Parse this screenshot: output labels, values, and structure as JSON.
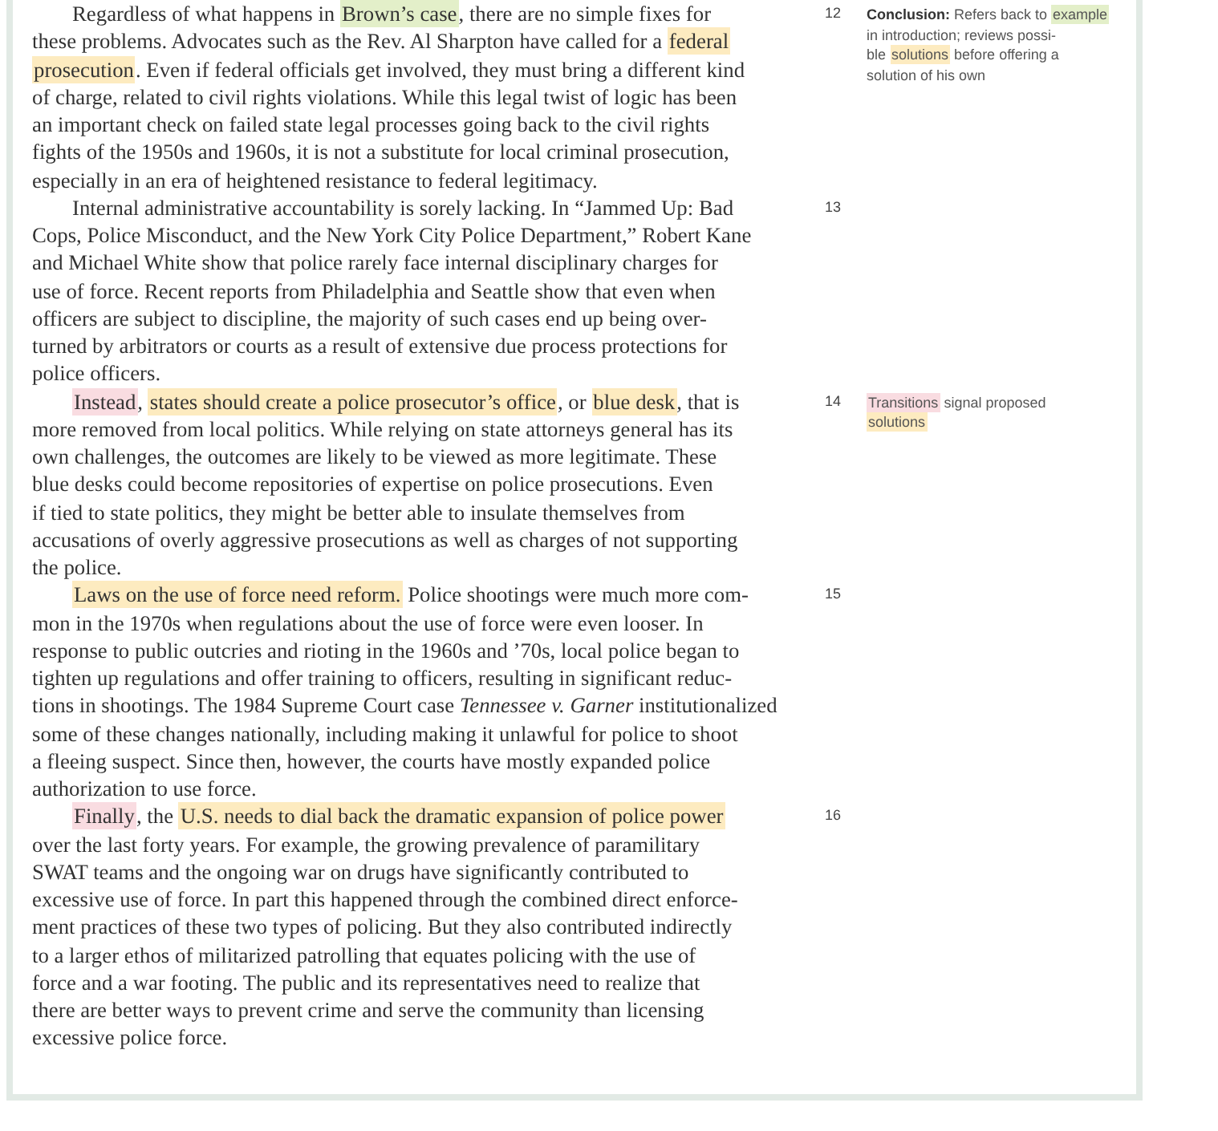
{
  "paragraphs": [
    {
      "number": "12",
      "lines": [
        [
          {
            "text": "Regardless of what happens in "
          },
          {
            "text": "Brown’s case",
            "color": "#e3efc9"
          },
          {
            "text": ", there are no simple fixes for"
          }
        ],
        [
          {
            "text": "these problems. Advocates such as the Rev. Al Sharpton have called for a "
          },
          {
            "text": "federal",
            "color": "#fdebc0"
          }
        ],
        [
          {
            "text": "prosecution",
            "color": "#fdebc0"
          },
          {
            "text": ". Even if federal officials get involved, they must bring a different kind"
          }
        ],
        [
          {
            "text": "of charge, related to civil rights violations. While this legal twist of logic has been"
          }
        ],
        [
          {
            "text": "an important check on failed state legal processes going back to the civil rights"
          }
        ],
        [
          {
            "text": "fights of the 1950s and 1960s, it is not a substitute for local criminal prosecution,"
          }
        ],
        [
          {
            "text": "especially in an era of heightened resistance to federal legitimacy."
          }
        ]
      ],
      "note": [
        [
          {
            "text": "**Conclusion:** Refers back to "
          },
          {
            "text": "example",
            "color": "#e3efc9"
          }
        ],
        [
          {
            "text": "in introduction; reviews possi-"
          }
        ],
        [
          {
            "text": "ble "
          },
          {
            "text": "solutions",
            "color": "#fdebc0"
          },
          {
            "text": " before offering a"
          }
        ],
        [
          {
            "text": "solution of his own"
          }
        ]
      ]
    },
    {
      "number": "13",
      "lines": [
        [
          {
            "text": "Internal administrative accountability is sorely lacking. In “Jammed Up: Bad"
          }
        ],
        [
          {
            "text": "Cops, Police Misconduct, and the New York City Police Department,” Robert Kane"
          }
        ],
        [
          {
            "text": "and Michael White show that police rarely face internal disciplinary charges for"
          }
        ],
        [
          {
            "text": "use of force. Recent reports from Philadelphia and Seattle show that even when"
          }
        ],
        [
          {
            "text": "officers are subject to discipline, the majority of such cases end up being over-"
          }
        ],
        [
          {
            "text": "turned by arbitrators or courts as a result of extensive due process protections for"
          }
        ],
        [
          {
            "text": "police officers."
          }
        ]
      ]
    },
    {
      "number": "14",
      "lines": [
        [
          {
            "text": "Instead",
            "color": "#f9dce1"
          },
          {
            "text": ", "
          },
          {
            "text": "states should create a police prosecutor’s office",
            "color": "#fdebc0"
          },
          {
            "text": ", or "
          },
          {
            "text": "blue desk",
            "color": "#fdebc0"
          },
          {
            "text": ", that is"
          }
        ],
        [
          {
            "text": "more removed from local politics. While relying on state attorneys general has its"
          }
        ],
        [
          {
            "text": "own challenges, the outcomes are likely to be viewed as more legitimate. These"
          }
        ],
        [
          {
            "text": "blue desks could become repositories of expertise on police prosecutions. Even"
          }
        ],
        [
          {
            "text": "if tied to state politics, they might be better able to insulate themselves from"
          }
        ],
        [
          {
            "text": "accusations of overly aggressive prosecutions as well as charges of not supporting"
          }
        ],
        [
          {
            "text": "the police."
          }
        ]
      ],
      "note": [
        [
          {
            "text": "Transitions",
            "color": "#f9dce1"
          },
          {
            "text": " signal proposed"
          }
        ],
        [
          {
            "text": "solutions",
            "color": "#fdebc0"
          }
        ]
      ]
    },
    {
      "number": "15",
      "lines": [
        [
          {
            "text": "Laws on the use of force need reform.",
            "color": "#fdebc0"
          },
          {
            "text": " Police shootings were much more com-"
          }
        ],
        [
          {
            "text": "mon in the 1970s when regulations about the use of force were even looser. In"
          }
        ],
        [
          {
            "text": "response to public outcries and rioting in the 1960s and ’70s, local police began to"
          }
        ],
        [
          {
            "text": "tighten up regulations and offer training to officers, resulting in significant reduc-"
          }
        ],
        [
          {
            "text": "tions in shootings. The 1984 Supreme Court case *Tennessee v. Garner* institutionalized"
          }
        ],
        [
          {
            "text": "some of these changes nationally, including making it unlawful for police to shoot"
          }
        ],
        [
          {
            "text": "a fleeing suspect. Since then, however, the courts have mostly expanded police"
          }
        ],
        [
          {
            "text": "authorization to use force."
          }
        ]
      ]
    },
    {
      "number": "16",
      "lines": [
        [
          {
            "text": "Finally",
            "color": "#f9dce1"
          },
          {
            "text": ", the "
          },
          {
            "text": "U.S. needs to dial back the dramatic expansion of police power",
            "color": "#fdebc0"
          }
        ],
        [
          {
            "text": "over the last forty years. For example, the growing prevalence of paramilitary"
          }
        ],
        [
          {
            "text": "SWAT teams and the ongoing war on drugs have significantly contributed to"
          }
        ],
        [
          {
            "text": "excessive use of force. In part this happened through the combined direct enforce-"
          }
        ],
        [
          {
            "text": "ment practices of these two types of policing. But they also contributed indirectly"
          }
        ],
        [
          {
            "text": "to a larger ethos of militarized patrolling that equates policing with the use of"
          }
        ],
        [
          {
            "text": "force and a war footing. The public and its representatives need to realize that"
          }
        ],
        [
          {
            "text": "there are better ways to prevent crime and serve the community than licensing"
          }
        ],
        [
          {
            "text": "excessive police force."
          }
        ]
      ]
    }
  ]
}
